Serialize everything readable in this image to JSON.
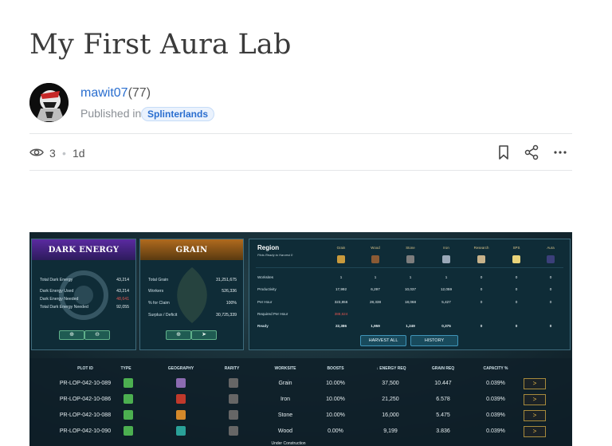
{
  "post": {
    "title": "My First Aura Lab",
    "author": "mawit07",
    "reputation": "(77)",
    "published_in": "Published in",
    "community": "Splinterlands",
    "views": "3",
    "separator": "•",
    "age": "1d"
  },
  "colors": {
    "link": "#2a6ecf",
    "badge_bg": "#eaf2fd",
    "game_bg": "#0b1c26",
    "negative": "#e2544f",
    "accent_gold": "#e6b84a"
  },
  "icons": [
    "eye-icon",
    "bookmark-icon",
    "share-icon",
    "more-icon"
  ],
  "game": {
    "dark_energy": {
      "title": "DARK ENERGY",
      "rows": [
        {
          "label": "Total Dark Energy",
          "value": "43,214"
        },
        {
          "label": "Dark Energy Used",
          "value": "43,214"
        },
        {
          "label": "Dark Energy Needed",
          "value": "48,641"
        },
        {
          "label": "Total Dark Energy Needed",
          "value": "92,055"
        }
      ],
      "buttons": [
        "⊕",
        "⊖"
      ]
    },
    "grain": {
      "title": "GRAIN",
      "rows": [
        {
          "label": "Total Grain",
          "value": "31,251,675"
        },
        {
          "label": "Workers",
          "value": "526,336"
        },
        {
          "label": "% for Claim",
          "value": "100%"
        },
        {
          "label": "Surplus / Deficit",
          "value": "30,725,339"
        }
      ],
      "buttons": [
        "⊕",
        "➤"
      ]
    },
    "region": {
      "title": "Region",
      "subtitle": "Plots Ready to Harvest 0",
      "resources": [
        "Grain",
        "Wood",
        "Stone",
        "Iron",
        "Research",
        "SPS",
        "Aura"
      ],
      "rows": [
        {
          "label": "Worksites",
          "values": [
            "1",
            "1",
            "1",
            "1",
            "0",
            "0",
            "0"
          ]
        },
        {
          "label": "Productivity",
          "values": [
            "17,992",
            "6,297",
            "10,037",
            "12,059",
            "0",
            "0",
            "0"
          ]
        },
        {
          "label": "Per Hour",
          "values": [
            "323,856",
            "28,338",
            "18,068",
            "5,427",
            "0",
            "0",
            "0"
          ]
        },
        {
          "label": "Required Per Hour",
          "values": [
            "388,624",
            "",
            "",
            "",
            "",
            "",
            ""
          ]
        },
        {
          "label": "Ready",
          "values": [
            "22,386",
            "1,959",
            "1,249",
            "0,375",
            "0",
            "0",
            "0"
          ]
        }
      ],
      "buttons": [
        "HARVEST ALL",
        "HISTORY"
      ]
    },
    "table": {
      "headers": [
        "PLOT ID",
        "TYPE",
        "GEOGRAPHY",
        "RARITY",
        "WORKSITE",
        "BOOSTS",
        "↓ ENERGY REQ",
        "GRAIN REQ",
        "CAPACITY %"
      ],
      "rows": [
        {
          "plot": "PR-LOP-042-10-089",
          "worksite": "Grain",
          "boosts": "10.00%",
          "energy": "37,500",
          "grain": "10.447",
          "capacity": "0.039%"
        },
        {
          "plot": "PR-LOP-042-10-086",
          "worksite": "Iron",
          "boosts": "10.00%",
          "energy": "21,250",
          "grain": "6.578",
          "capacity": "0.039%"
        },
        {
          "plot": "PR-LOP-042-10-088",
          "worksite": "Stone",
          "boosts": "10.00%",
          "energy": "16,000",
          "grain": "5.475",
          "capacity": "0.039%"
        },
        {
          "plot": "PR-LOP-042-10-090",
          "worksite": "Wood",
          "boosts": "0.00%",
          "energy": "9,199",
          "grain": "3.836",
          "capacity": "0.039%"
        }
      ],
      "partial_row_text": "Under Construction",
      "arrow": ">"
    }
  }
}
